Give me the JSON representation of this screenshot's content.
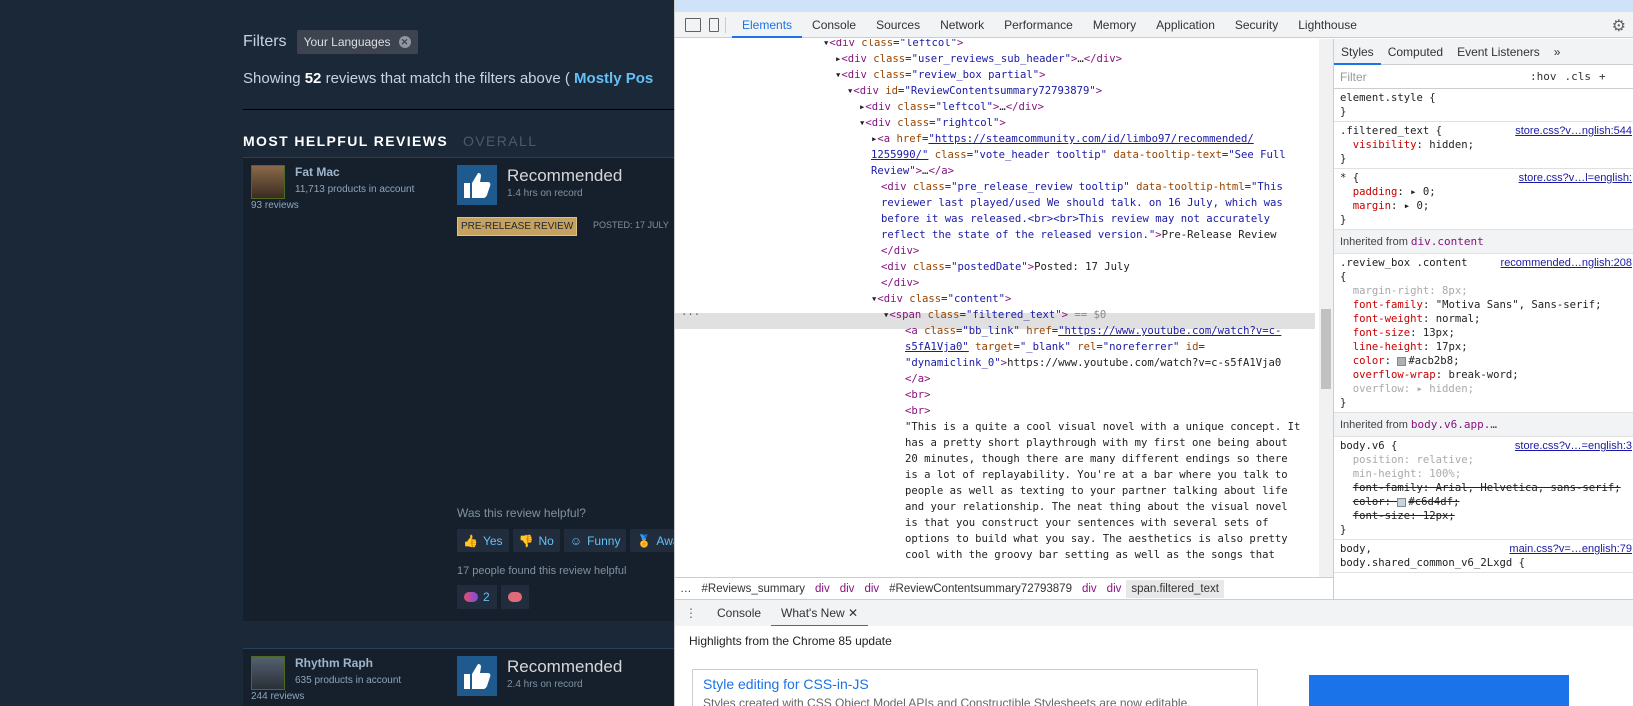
{
  "steam": {
    "filters_label": "Filters",
    "filter_chip": "Your Languages",
    "showing_prefix": "Showing",
    "showing_count": "52",
    "showing_mid": "reviews that match the filters above (",
    "showing_rating": "Mostly Pos",
    "most_helpful": "MOST HELPFUL REVIEWS",
    "overall": "OVERALL",
    "reviews": [
      {
        "user": "Fat Mac",
        "products": "11,713 products in account",
        "review_count": "93 reviews",
        "verdict": "Recommended",
        "hours": "1.4 hrs on record",
        "badge": "PRE-RELEASE REVIEW",
        "posted": "POSTED: 17 JULY",
        "helpful_q": "Was this review helpful?",
        "yes": "Yes",
        "no": "No",
        "funny": "Funny",
        "award": "Awar",
        "found_helpful": "17 people found this review helpful",
        "award_count": "2"
      },
      {
        "user": "Rhythm Raph",
        "products": "635 products in account",
        "review_count": "244 reviews",
        "verdict": "Recommended",
        "hours": "2.4 hrs on record"
      }
    ]
  },
  "devtools": {
    "tabs": [
      "Elements",
      "Console",
      "Sources",
      "Network",
      "Performance",
      "Memory",
      "Application",
      "Security",
      "Lighthouse"
    ],
    "styles_tabs": [
      "Styles",
      "Computed",
      "Event Listeners"
    ],
    "styles_more": "»",
    "filter_placeholder": "Filter",
    "hov": ":hov",
    "cls": ".cls",
    "plus": "+",
    "breadcrumbs": [
      "…",
      "#Reviews_summary",
      "div",
      "div",
      "div",
      "#ReviewContentsummary72793879",
      "div",
      "div",
      "span.filtered_text"
    ],
    "drawer_tabs": [
      "Console",
      "What's New"
    ],
    "whats_new_heading": "Highlights from the Chrome 85 update",
    "whats_new_title": "Style editing for CSS-in-JS",
    "whats_new_desc": "Styles created with CSS Object Model APIs and Constructible Stylesheets are now editable."
  }
}
